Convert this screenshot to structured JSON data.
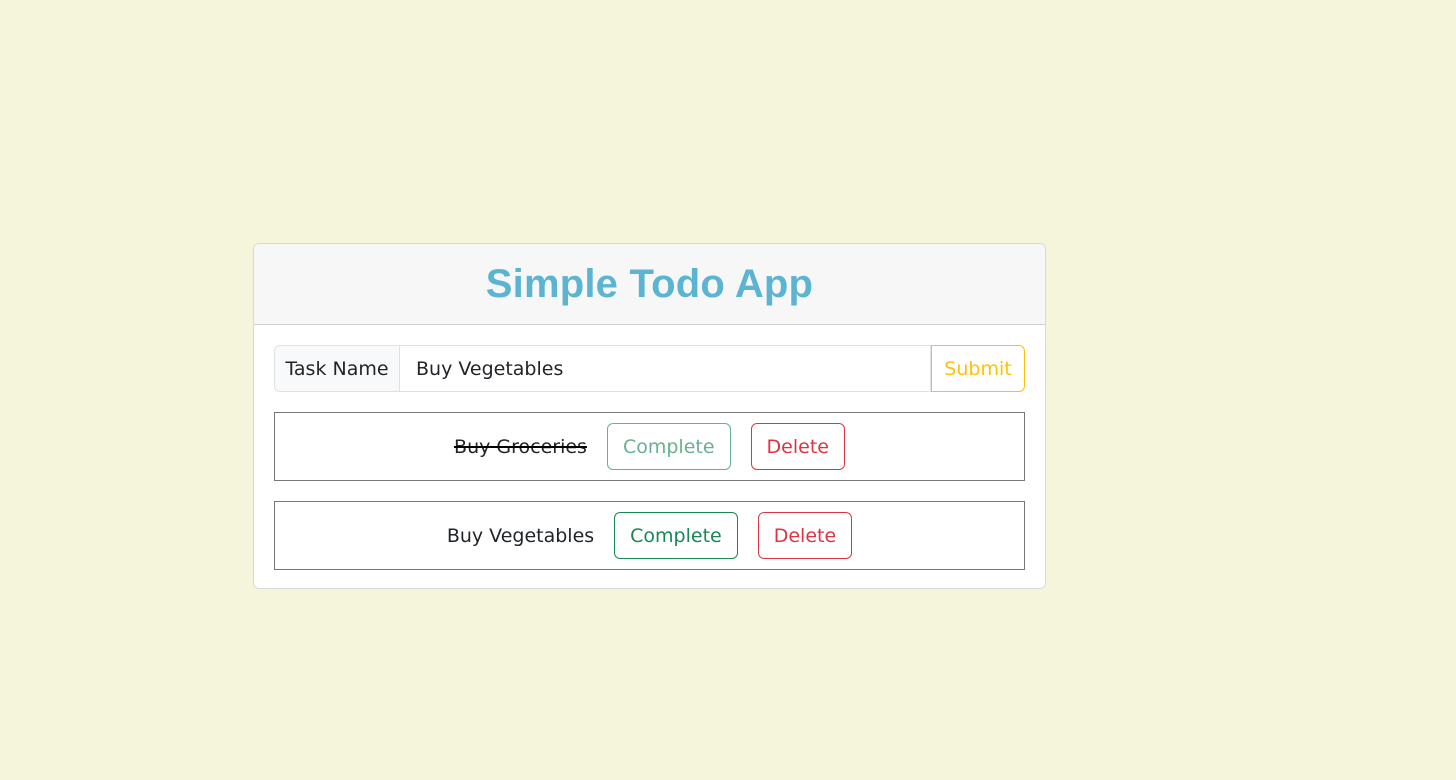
{
  "app": {
    "title": "Simple Todo App"
  },
  "form": {
    "label": "Task Name",
    "input_value": "Buy Vegetables",
    "submit_label": "Submit"
  },
  "todos": [
    {
      "text": "Buy Groceries",
      "completed": true,
      "complete_label": "Complete",
      "delete_label": "Delete"
    },
    {
      "text": "Buy Vegetables",
      "completed": false,
      "complete_label": "Complete",
      "delete_label": "Delete"
    }
  ],
  "colors": {
    "background": "#f5f5dc",
    "title": "#5bb4d2",
    "submit": "#ffc107",
    "complete": "#198754",
    "delete": "#dc3545"
  }
}
